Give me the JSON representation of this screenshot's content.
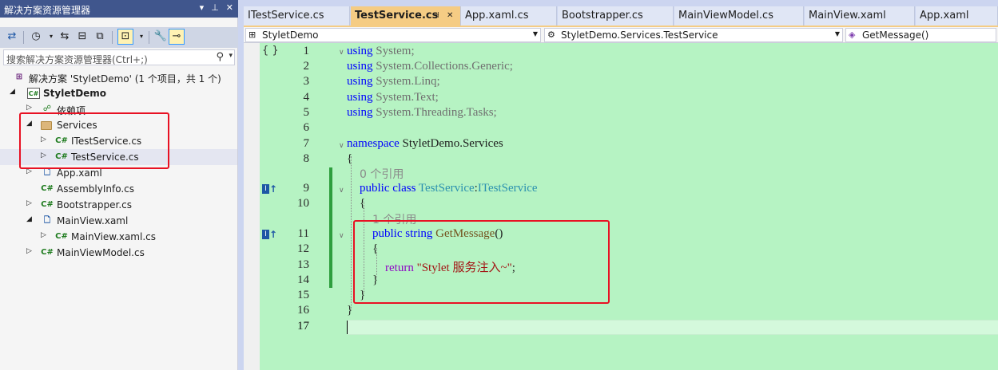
{
  "explorer": {
    "title": "解决方案资源管理器",
    "title_buttons": [
      "▾",
      "⊥",
      "✕"
    ],
    "search_placeholder": "搜索解决方案资源管理器(Ctrl+;)",
    "tree": [
      {
        "label": "解决方案 'StyletDemo' (1 个项目，共 1 个)",
        "icon": "solution-icon",
        "glyph": "⊞",
        "level": 0,
        "arrow": "",
        "bold": false
      },
      {
        "label": "StyletDemo",
        "icon": "csharp-project-icon",
        "glyph": "C#",
        "level": 0,
        "arrow": "◢",
        "bold": true
      },
      {
        "label": "依赖项",
        "icon": "dependencies-icon",
        "glyph": "☍",
        "level": 1,
        "arrow": "▷",
        "bold": false
      },
      {
        "label": "Services",
        "icon": "folder-icon",
        "glyph": "",
        "level": 1,
        "arrow": "◢",
        "bold": false
      },
      {
        "label": "ITestService.cs",
        "icon": "csharp-file-icon",
        "glyph": "C#",
        "level": 2,
        "arrow": "▷",
        "bold": false
      },
      {
        "label": "TestService.cs",
        "icon": "csharp-file-icon",
        "glyph": "C#",
        "level": 2,
        "arrow": "▷",
        "bold": false,
        "selected": true
      },
      {
        "label": "App.xaml",
        "icon": "xaml-file-icon",
        "glyph": "🗋",
        "level": 1,
        "arrow": "▷",
        "bold": false
      },
      {
        "label": "AssemblyInfo.cs",
        "icon": "csharp-file-icon",
        "glyph": "C#",
        "level": 1,
        "arrow": "",
        "bold": false
      },
      {
        "label": "Bootstrapper.cs",
        "icon": "csharp-file-icon",
        "glyph": "C#",
        "level": 1,
        "arrow": "▷",
        "bold": false
      },
      {
        "label": "MainView.xaml",
        "icon": "xaml-file-icon",
        "glyph": "🗋",
        "level": 1,
        "arrow": "◢",
        "bold": false
      },
      {
        "label": "MainView.xaml.cs",
        "icon": "csharp-file-icon",
        "glyph": "C#",
        "level": 2,
        "arrow": "▷",
        "bold": false
      },
      {
        "label": "MainViewModel.cs",
        "icon": "csharp-file-icon",
        "glyph": "C#",
        "level": 1,
        "arrow": "▷",
        "bold": false
      }
    ]
  },
  "tabs": [
    {
      "label": "ITestService.cs",
      "active": false
    },
    {
      "label": "TestService.cs",
      "active": true,
      "pin": "⊣",
      "close": "✕"
    },
    {
      "label": "App.xaml.cs",
      "active": false
    },
    {
      "label": "Bootstrapper.cs",
      "active": false
    },
    {
      "label": "MainViewModel.cs",
      "active": false
    },
    {
      "label": "MainView.xaml",
      "active": false
    },
    {
      "label": "App.xaml",
      "active": false
    }
  ],
  "navbar": {
    "project": "StyletDemo",
    "class": "StyletDemo.Services.TestService",
    "member": "GetMessage()"
  },
  "code": {
    "line_numbers": [
      "1",
      "2",
      "3",
      "4",
      "5",
      "6",
      "7",
      "8",
      "9",
      "10",
      "11",
      "12",
      "13",
      "14",
      "15",
      "16",
      "17"
    ],
    "lens_refs_0": "0 个引用",
    "lens_refs_1": "1 个引用",
    "l1_kw": "using",
    "l1_rest": " System;",
    "l2_kw": "using",
    "l2_rest": " System.Collections.Generic;",
    "l3_kw": "using",
    "l3_rest": " System.Linq;",
    "l4_kw": "using",
    "l4_rest": " System.Text;",
    "l5_kw": "using",
    "l5_rest": " System.Threading.Tasks;",
    "l7_kw": "namespace",
    "l7_rest": " StyletDemo.Services",
    "l8": "{",
    "l9_kw": "public class",
    "l9_type": "TestService",
    "l9_colon": ":",
    "l9_iface": "ITestService",
    "l10": "{",
    "l11_kw": "public string",
    "l11_method": "GetMessage",
    "l11_parens": "()",
    "l12": "{",
    "l13_kw": "return",
    "l13_str": "\"Stylet 服务注入~\"",
    "l13_end": ";",
    "l14": "}",
    "l15": "}",
    "l16": "}"
  }
}
